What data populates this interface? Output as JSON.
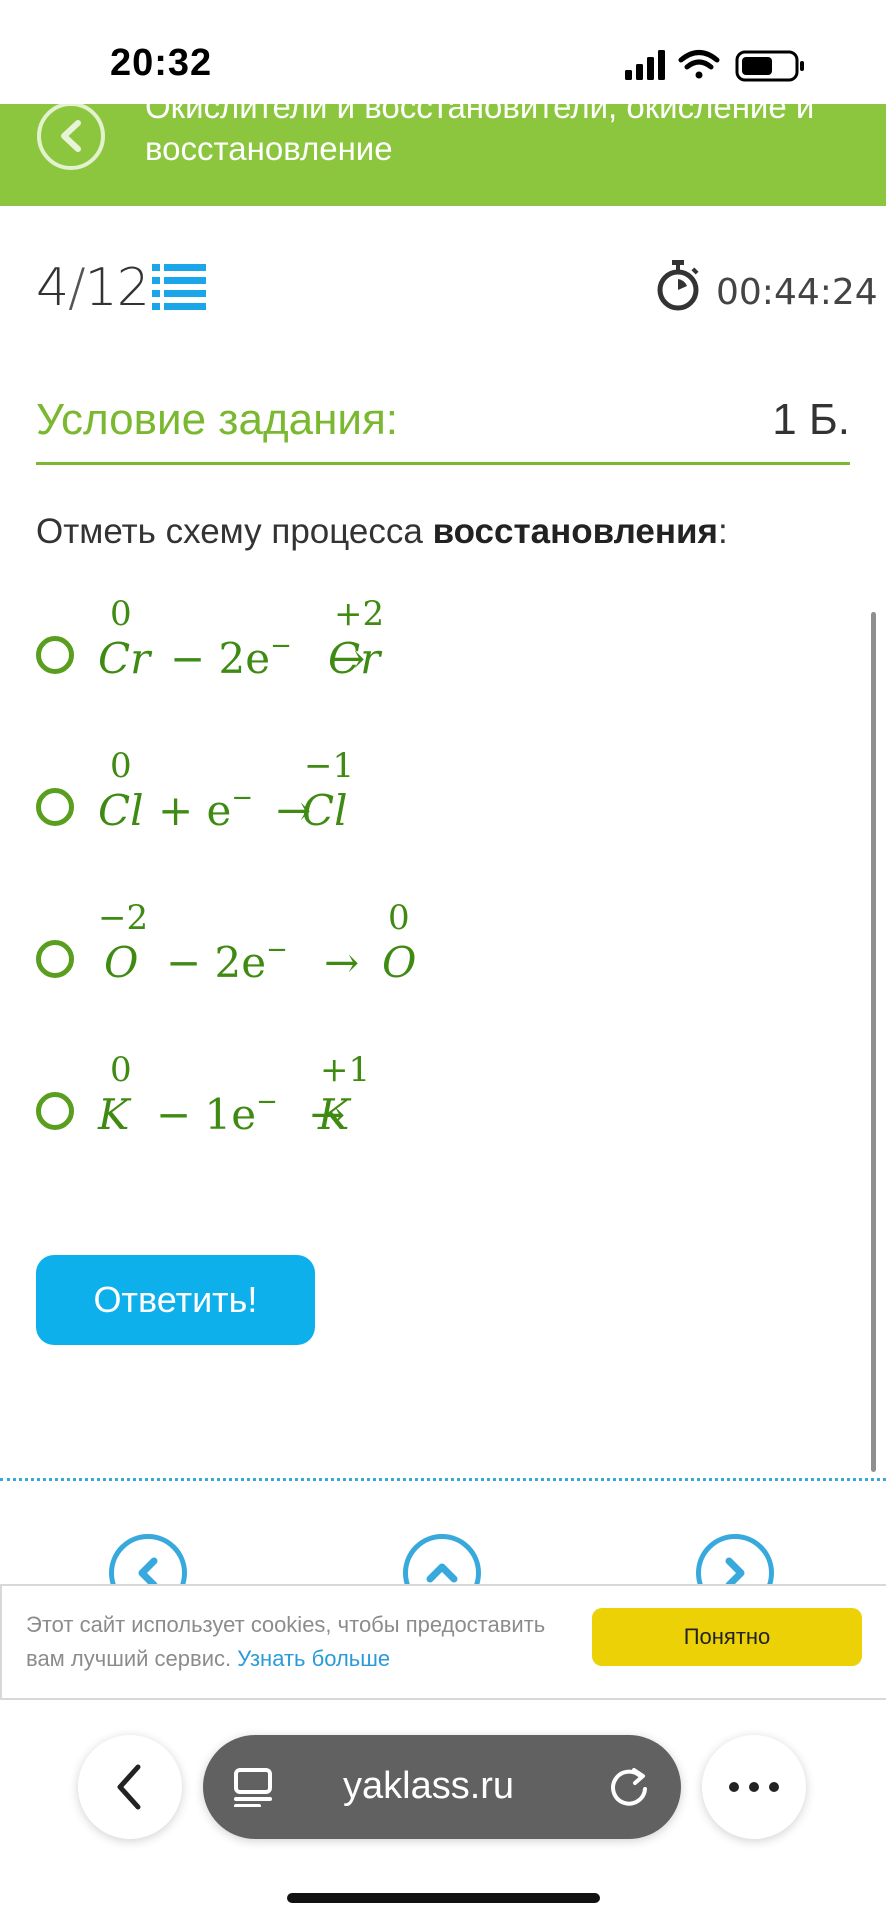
{
  "status": {
    "time": "20:32"
  },
  "topbar": {
    "title": "Окислители и восстановители, окисление и восстановление"
  },
  "progress": {
    "current": "4",
    "separator": "/",
    "total": "12"
  },
  "timer": {
    "value": "00:44:24"
  },
  "condition": {
    "title": "Условие задания:",
    "points": "1 Б."
  },
  "question": {
    "prefix": "Отметь схему процесса ",
    "bold": "восстановления",
    "suffix": ":"
  },
  "options": [
    {
      "el1": "Cr",
      "ox1": "0",
      "middle": "− 2e",
      "arrow": "→",
      "el2": "Cr",
      "ox2": "+2"
    },
    {
      "el1": "Cl",
      "ox1": "0",
      "middle": "+ e",
      "arrow": "→",
      "el2": "Cl",
      "ox2": "−1"
    },
    {
      "el1": "O",
      "ox1": "−2",
      "middle": "− 2e",
      "arrow": "→",
      "el2": "O",
      "ox2": "0"
    },
    {
      "el1": "K",
      "ox1": "0",
      "middle": "− 1e",
      "arrow": "→",
      "el2": "K",
      "ox2": "+1"
    }
  ],
  "electron_charge": "−",
  "answer_button": "Ответить!",
  "cookie": {
    "text": "Этот сайт использует cookies, чтобы предоставить вам лучший сервис. ",
    "link": "Узнать больше",
    "button": "Понятно"
  },
  "browser": {
    "url": "yaklass.ru"
  },
  "colors": {
    "green": "#8cc63f",
    "formula_green": "#3f8a12",
    "blue": "#0eb0ec",
    "yellow": "#ecd107"
  }
}
